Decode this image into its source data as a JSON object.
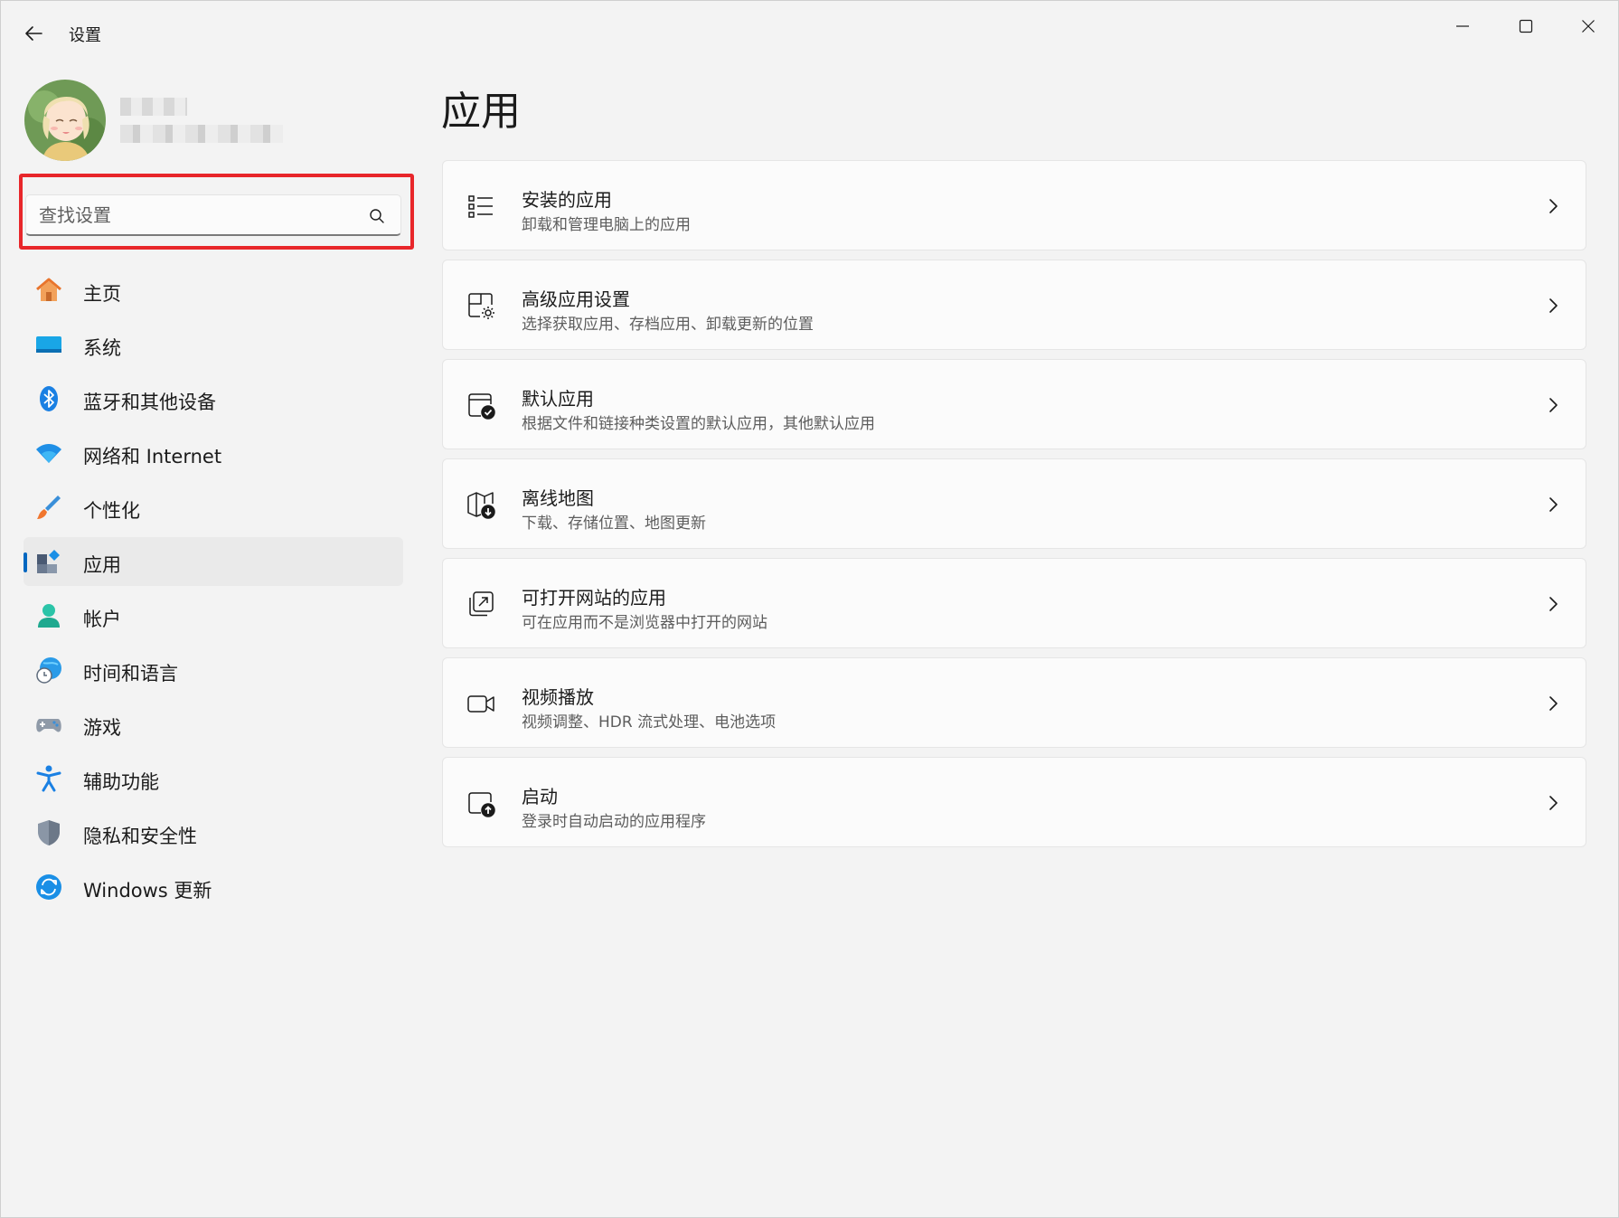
{
  "titlebar": {
    "title": "设置",
    "back_icon": "arrow-left-icon",
    "minimize_icon": "minimize-icon",
    "maximize_icon": "maximize-icon",
    "close_icon": "close-icon"
  },
  "user": {
    "avatar_icon": "avatar-image"
  },
  "search": {
    "value": "",
    "placeholder": "查找设置",
    "icon": "search-icon",
    "highlight_color": "#e8262a"
  },
  "sidebar": {
    "accent_color": "#0067c0",
    "items": [
      {
        "label": "主页",
        "icon": "home-icon",
        "active": false
      },
      {
        "label": "系统",
        "icon": "monitor-icon",
        "active": false
      },
      {
        "label": "蓝牙和其他设备",
        "icon": "bluetooth-icon",
        "active": false
      },
      {
        "label": "网络和 Internet",
        "icon": "wifi-icon",
        "active": false
      },
      {
        "label": "个性化",
        "icon": "paintbrush-icon",
        "active": false
      },
      {
        "label": "应用",
        "icon": "apps-icon",
        "active": true
      },
      {
        "label": "帐户",
        "icon": "person-icon",
        "active": false
      },
      {
        "label": "时间和语言",
        "icon": "globe-clock-icon",
        "active": false
      },
      {
        "label": "游戏",
        "icon": "gamepad-icon",
        "active": false
      },
      {
        "label": "辅助功能",
        "icon": "accessibility-icon",
        "active": false
      },
      {
        "label": "隐私和安全性",
        "icon": "shield-icon",
        "active": false
      },
      {
        "label": "Windows 更新",
        "icon": "update-icon",
        "active": false
      }
    ]
  },
  "main": {
    "title": "应用",
    "cards": [
      {
        "title": "安装的应用",
        "subtitle": "卸载和管理电脑上的应用",
        "icon": "list-icon"
      },
      {
        "title": "高级应用设置",
        "subtitle": "选择获取应用、存档应用、卸载更新的位置",
        "icon": "app-gear-icon"
      },
      {
        "title": "默认应用",
        "subtitle": "根据文件和链接种类设置的默认应用，其他默认应用",
        "icon": "window-check-icon"
      },
      {
        "title": "离线地图",
        "subtitle": "下载、存储位置、地图更新",
        "icon": "map-download-icon"
      },
      {
        "title": "可打开网站的应用",
        "subtitle": "可在应用而不是浏览器中打开的网站",
        "icon": "open-external-icon"
      },
      {
        "title": "视频播放",
        "subtitle": "视频调整、HDR 流式处理、电池选项",
        "icon": "video-camera-icon"
      },
      {
        "title": "启动",
        "subtitle": "登录时自动启动的应用程序",
        "icon": "startup-icon"
      }
    ],
    "chevron_icon": "chevron-right-icon"
  }
}
